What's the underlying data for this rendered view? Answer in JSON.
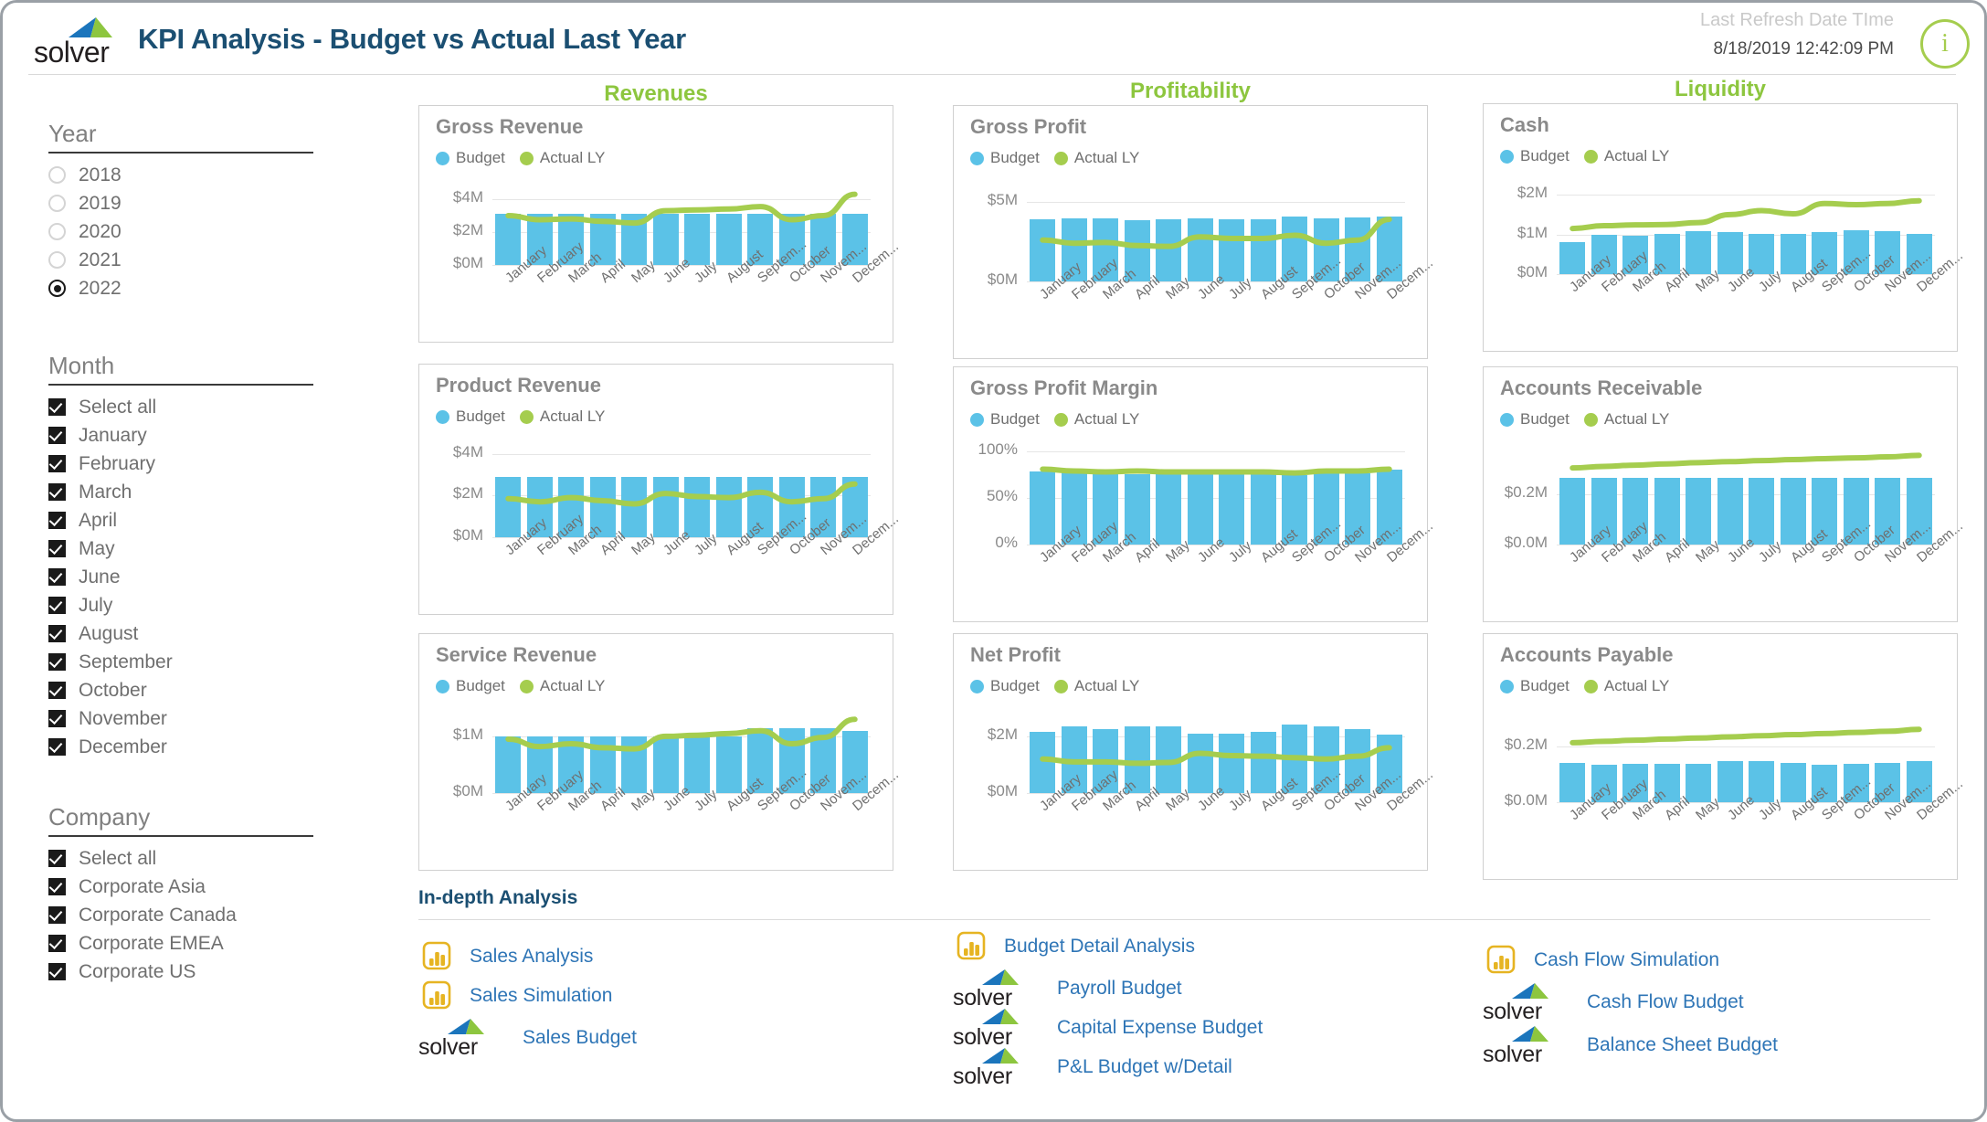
{
  "header": {
    "logo_text": "solver",
    "title": "KPI Analysis - Budget vs Actual Last Year",
    "refresh_label": "Last Refresh Date TIme",
    "refresh_value": "8/18/2019 12:42:09 PM",
    "info_icon": "i"
  },
  "sidebar": {
    "year": {
      "title": "Year",
      "options": [
        "2018",
        "2019",
        "2020",
        "2021",
        "2022"
      ],
      "selected": "2022"
    },
    "month": {
      "title": "Month",
      "options": [
        "Select all",
        "January",
        "February",
        "March",
        "April",
        "May",
        "June",
        "July",
        "August",
        "September",
        "October",
        "November",
        "December"
      ]
    },
    "company": {
      "title": "Company",
      "options": [
        "Select all",
        "Corporate Asia",
        "Corporate Canada",
        "Corporate EMEA",
        "Corporate US"
      ]
    }
  },
  "sections": {
    "revenues": "Revenues",
    "profitability": "Profitability",
    "liquidity": "Liquidity"
  },
  "legend": {
    "budget": "Budget",
    "actual": "Actual LY"
  },
  "colors": {
    "budget_bar": "#5BC2E7",
    "actual_line": "#A5CD4E",
    "section_header": "#8DC63F",
    "title": "#1b4f72",
    "link": "#2E75B6",
    "powerbi": "#E6B422"
  },
  "bottom": {
    "heading": "In-depth Analysis",
    "columns": [
      {
        "links": [
          {
            "icon": "powerbi-icon",
            "label": "Sales  Analysis"
          },
          {
            "icon": "powerbi-icon",
            "label": "Sales Simulation"
          },
          {
            "icon": "solver-logo-icon",
            "label": "Sales Budget"
          }
        ]
      },
      {
        "links": [
          {
            "icon": "powerbi-icon",
            "label": "Budget Detail Analysis"
          },
          {
            "icon": "solver-logo-icon",
            "label": "Payroll Budget"
          },
          {
            "icon": "solver-logo-icon",
            "label": "Capital Expense Budget"
          },
          {
            "icon": "solver-logo-icon",
            "label": "P&L Budget w/Detail"
          }
        ]
      },
      {
        "links": [
          {
            "icon": "powerbi-icon",
            "label": "Cash Flow Simulation"
          },
          {
            "icon": "solver-logo-icon",
            "label": "Cash Flow Budget"
          },
          {
            "icon": "solver-logo-icon",
            "label": "Balance Sheet Budget"
          }
        ]
      }
    ]
  },
  "chart_data": [
    {
      "id": "gross-revenue",
      "type": "bar",
      "title": "Gross Revenue",
      "categories": [
        "January",
        "February",
        "March",
        "April",
        "May",
        "June",
        "July",
        "August",
        "Septem...",
        "October",
        "Novem...",
        "Decem..."
      ],
      "ytick_labels": [
        "$0M",
        "$2M",
        "$4M"
      ],
      "ytick_values": [
        0,
        2,
        4
      ],
      "ylim": [
        0,
        5
      ],
      "series": [
        {
          "name": "Budget",
          "type": "bar",
          "values": [
            3.1,
            3.1,
            3.1,
            3.1,
            3.1,
            3.1,
            3.1,
            3.1,
            3.1,
            3.1,
            3.1,
            3.1
          ]
        },
        {
          "name": "Actual LY",
          "type": "line",
          "values": [
            3.0,
            2.75,
            2.8,
            2.65,
            2.55,
            3.3,
            3.35,
            3.4,
            3.55,
            2.75,
            3.0,
            4.3
          ]
        }
      ]
    },
    {
      "id": "product-revenue",
      "type": "bar",
      "title": "Product Revenue",
      "categories": [
        "January",
        "February",
        "March",
        "April",
        "May",
        "June",
        "July",
        "August",
        "Septem...",
        "October",
        "Novem...",
        "Decem..."
      ],
      "ytick_labels": [
        "$0M",
        "$2M",
        "$4M"
      ],
      "ytick_values": [
        0,
        2,
        4
      ],
      "ylim": [
        0,
        4.6
      ],
      "series": [
        {
          "name": "Budget",
          "type": "bar",
          "values": [
            2.9,
            2.9,
            2.9,
            2.9,
            2.9,
            2.9,
            2.9,
            2.9,
            2.9,
            2.9,
            2.9,
            2.9
          ]
        },
        {
          "name": "Actual LY",
          "type": "line",
          "values": [
            1.85,
            1.7,
            1.9,
            1.75,
            1.6,
            2.1,
            1.95,
            1.9,
            2.15,
            1.7,
            1.85,
            2.55
          ]
        }
      ]
    },
    {
      "id": "service-revenue",
      "type": "bar",
      "title": "Service Revenue",
      "categories": [
        "January",
        "February",
        "March",
        "April",
        "May",
        "June",
        "July",
        "August",
        "Septem...",
        "October",
        "Novem...",
        "Decem..."
      ],
      "ytick_labels": [
        "$0M",
        "$1M"
      ],
      "ytick_values": [
        0,
        1
      ],
      "ylim": [
        0,
        1.45
      ],
      "series": [
        {
          "name": "Budget",
          "type": "bar",
          "values": [
            1.0,
            1.0,
            1.0,
            1.0,
            1.0,
            1.0,
            1.0,
            1.0,
            1.15,
            1.15,
            1.15,
            1.1
          ]
        },
        {
          "name": "Actual LY",
          "type": "line",
          "values": [
            0.95,
            0.82,
            0.87,
            0.8,
            0.78,
            1.0,
            1.02,
            1.05,
            1.1,
            0.87,
            0.98,
            1.3
          ]
        }
      ]
    },
    {
      "id": "gross-profit",
      "type": "bar",
      "title": "Gross Profit",
      "categories": [
        "January",
        "February",
        "March",
        "April",
        "May",
        "June",
        "July",
        "August",
        "Septem...",
        "October",
        "Novem...",
        "Decem..."
      ],
      "ytick_labels": [
        "$0M",
        "$5M"
      ],
      "ytick_values": [
        0,
        5
      ],
      "ylim": [
        0,
        6.2
      ],
      "series": [
        {
          "name": "Budget",
          "type": "bar",
          "values": [
            3.9,
            3.95,
            3.95,
            3.85,
            3.9,
            3.95,
            3.9,
            3.9,
            4.05,
            3.95,
            4.0,
            4.1
          ]
        },
        {
          "name": "Actual LY",
          "type": "line",
          "values": [
            2.6,
            2.4,
            2.45,
            2.25,
            2.2,
            2.8,
            2.7,
            2.7,
            2.9,
            2.4,
            2.6,
            3.9
          ]
        }
      ]
    },
    {
      "id": "gross-profit-margin",
      "type": "bar",
      "title": "Gross Profit Margin",
      "categories": [
        "January",
        "February",
        "March",
        "April",
        "May",
        "June",
        "July",
        "August",
        "Septem...",
        "October",
        "Novem...",
        "Decem..."
      ],
      "ytick_labels": [
        "0%",
        "50%",
        "100%"
      ],
      "ytick_values": [
        0,
        50,
        100
      ],
      "ylim": [
        0,
        108
      ],
      "series": [
        {
          "name": "Budget",
          "type": "bar",
          "values": [
            79,
            78,
            77,
            76,
            77,
            77,
            77,
            76,
            75,
            77,
            77,
            81
          ]
        },
        {
          "name": "Actual LY",
          "type": "line",
          "values": [
            81,
            79,
            78,
            79,
            78,
            78,
            78,
            78,
            77,
            79,
            79,
            81
          ]
        }
      ]
    },
    {
      "id": "net-profit",
      "type": "bar",
      "title": "Net Profit",
      "categories": [
        "January",
        "February",
        "March",
        "April",
        "May",
        "June",
        "July",
        "August",
        "Septem...",
        "October",
        "Novem...",
        "Decem..."
      ],
      "ytick_labels": [
        "$0M",
        "$2M"
      ],
      "ytick_values": [
        0,
        2
      ],
      "ylim": [
        0,
        2.9
      ],
      "series": [
        {
          "name": "Budget",
          "type": "bar",
          "values": [
            2.15,
            2.35,
            2.25,
            2.35,
            2.35,
            2.1,
            2.08,
            2.15,
            2.42,
            2.35,
            2.25,
            2.05
          ]
        },
        {
          "name": "Actual LY",
          "type": "line",
          "values": [
            1.2,
            1.1,
            1.1,
            1.05,
            1.08,
            1.4,
            1.32,
            1.3,
            1.25,
            1.2,
            1.3,
            1.6
          ]
        }
      ]
    },
    {
      "id": "cash",
      "type": "bar",
      "title": "Cash",
      "categories": [
        "January",
        "February",
        "March",
        "April",
        "May",
        "June",
        "July",
        "August",
        "Septem...",
        "October",
        "Novem...",
        "Decem..."
      ],
      "ytick_labels": [
        "$0M",
        "$1M",
        "$2M"
      ],
      "ytick_values": [
        0,
        1,
        2
      ],
      "ylim": [
        0,
        2.35
      ],
      "series": [
        {
          "name": "Budget",
          "type": "bar",
          "values": [
            0.8,
            0.98,
            0.96,
            1.02,
            1.08,
            1.05,
            1.02,
            1.01,
            1.06,
            1.1,
            1.08,
            1.02
          ]
        },
        {
          "name": "Actual LY",
          "type": "line",
          "values": [
            1.15,
            1.22,
            1.24,
            1.25,
            1.3,
            1.5,
            1.6,
            1.52,
            1.78,
            1.75,
            1.78,
            1.85
          ]
        }
      ]
    },
    {
      "id": "accounts-receivable",
      "type": "bar",
      "title": "Accounts Receivable",
      "categories": [
        "January",
        "February",
        "March",
        "April",
        "May",
        "June",
        "July",
        "August",
        "Septem...",
        "October",
        "Novem...",
        "Decem..."
      ],
      "ytick_labels": [
        "$0.0M",
        "$0.2M"
      ],
      "ytick_values": [
        0,
        0.2
      ],
      "ylim": [
        0,
        0.4
      ],
      "series": [
        {
          "name": "Budget",
          "type": "bar",
          "values": [
            0.265,
            0.265,
            0.265,
            0.265,
            0.265,
            0.265,
            0.265,
            0.265,
            0.265,
            0.265,
            0.265,
            0.265
          ]
        },
        {
          "name": "Actual LY",
          "type": "line",
          "values": [
            0.305,
            0.311,
            0.316,
            0.321,
            0.326,
            0.33,
            0.334,
            0.338,
            0.342,
            0.345,
            0.349,
            0.355
          ]
        }
      ]
    },
    {
      "id": "accounts-payable",
      "type": "bar",
      "title": "Accounts Payable",
      "categories": [
        "January",
        "February",
        "March",
        "April",
        "May",
        "June",
        "July",
        "August",
        "Septem...",
        "October",
        "Novem...",
        "Decem..."
      ],
      "ytick_labels": [
        "$0.0M",
        "$0.2M"
      ],
      "ytick_values": [
        0,
        0.2
      ],
      "ylim": [
        0,
        0.33
      ],
      "series": [
        {
          "name": "Budget",
          "type": "bar",
          "values": [
            0.142,
            0.136,
            0.14,
            0.138,
            0.138,
            0.147,
            0.147,
            0.142,
            0.134,
            0.137,
            0.142,
            0.147
          ]
        },
        {
          "name": "Actual LY",
          "type": "line",
          "values": [
            0.215,
            0.22,
            0.224,
            0.228,
            0.232,
            0.236,
            0.24,
            0.244,
            0.248,
            0.252,
            0.256,
            0.263
          ]
        }
      ]
    }
  ]
}
